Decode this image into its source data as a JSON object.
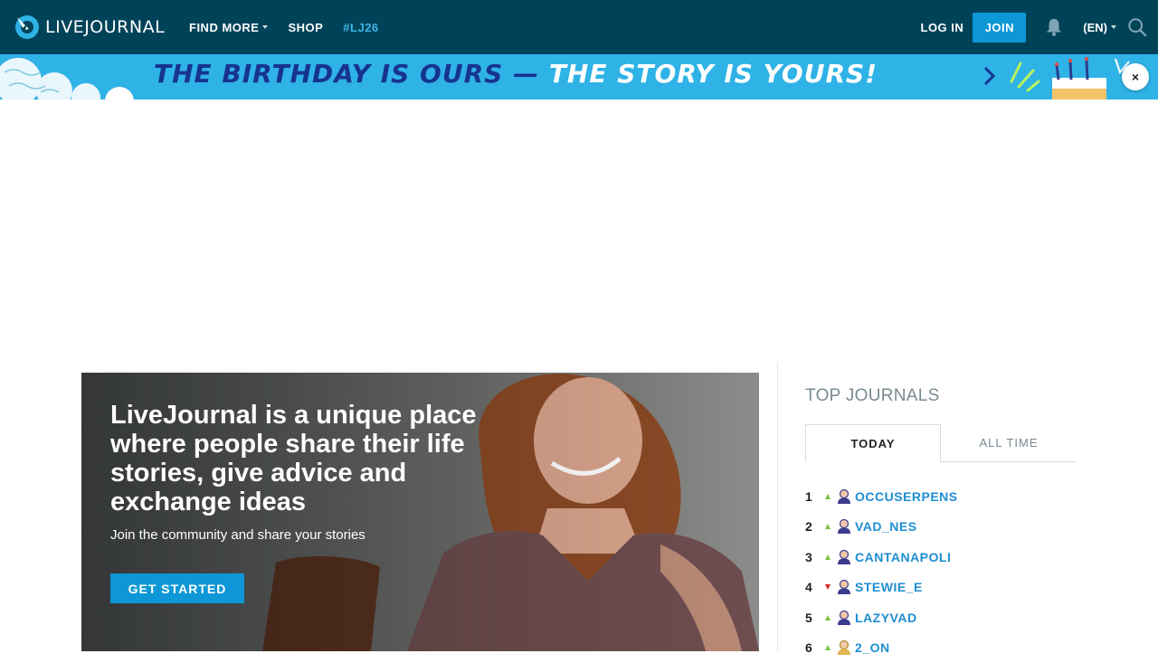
{
  "header": {
    "logo_text": "LIVEJOURNAL",
    "nav": {
      "find_more": "FIND MORE",
      "shop": "SHOP",
      "tag": "#LJ26"
    },
    "login": "LOG IN",
    "join": "JOIN",
    "lang": "(EN)"
  },
  "banner": {
    "part1": "THE BIRTHDAY IS OURS — ",
    "part2": "THE STORY IS YOURS!",
    "close": "×"
  },
  "hero": {
    "title": "LiveJournal is a unique place where people share their life stories, give advice and exchange ideas",
    "subtitle": "Join the community and share your stories",
    "cta": "GET STARTED"
  },
  "top_journals": {
    "title": "TOP JOURNALS",
    "tabs": [
      "TODAY",
      "ALL TIME"
    ],
    "items": [
      {
        "rank": "1",
        "trend": "up",
        "name": "OCCUSERPENS",
        "gender": "male"
      },
      {
        "rank": "2",
        "trend": "up",
        "name": "VAD_NES",
        "gender": "male"
      },
      {
        "rank": "3",
        "trend": "up",
        "name": "CANTANAPOLI",
        "gender": "male"
      },
      {
        "rank": "4",
        "trend": "down",
        "name": "STEWIE_E",
        "gender": "male"
      },
      {
        "rank": "5",
        "trend": "up",
        "name": "LAZYVAD",
        "gender": "male"
      },
      {
        "rank": "6",
        "trend": "up",
        "name": "2_ON",
        "gender": "female"
      }
    ]
  },
  "colors": {
    "header_bg": "#004359",
    "accent_blue": "#0d97d6",
    "banner_bg": "#2fb2e6",
    "banner_text": "#16348f",
    "link": "#1d8ed1",
    "trend_up": "#7ac142",
    "trend_down": "#d9262a"
  },
  "icons": {
    "logo": "livejournal-pencil-icon",
    "bell": "bell-icon",
    "search": "search-icon",
    "user": "user-icon",
    "close": "close-icon"
  }
}
